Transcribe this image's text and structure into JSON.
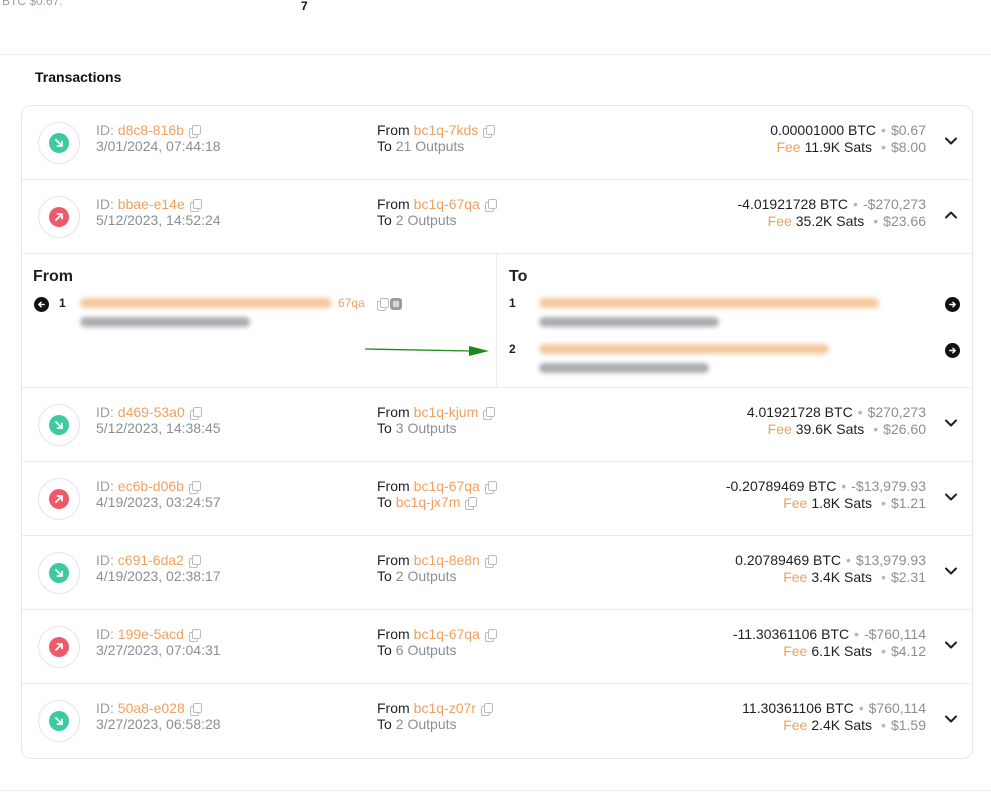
{
  "top_fragment": {
    "btc_hint": "BTC $0.67.",
    "number": "7"
  },
  "section": {
    "title": "Transactions"
  },
  "labels": {
    "id_prefix": "ID:",
    "from": "From",
    "to": "To",
    "fee": "Fee",
    "detail_from": "From",
    "detail_to": "To"
  },
  "transactions": [
    {
      "direction": "in",
      "id": "d8c8-816b",
      "date": "3/01/2024, 07:44:18",
      "from": "bc1q-7kds",
      "to_outputs": "21 Outputs",
      "amount": "0.00001000 BTC",
      "amount_usd": "$0.67",
      "fee_sats": "11.9K Sats",
      "fee_usd": "$8.00",
      "expanded": false
    },
    {
      "direction": "out",
      "id": "bbae-e14e",
      "date": "5/12/2023, 14:52:24",
      "from": "bc1q-67qa",
      "to_outputs": "2 Outputs",
      "amount": "-4.01921728 BTC",
      "amount_usd": "-$270,273",
      "fee_sats": "35.2K Sats",
      "fee_usd": "$23.66",
      "expanded": true
    },
    {
      "direction": "in",
      "id": "d469-53a0",
      "date": "5/12/2023, 14:38:45",
      "from": "bc1q-kjum",
      "to_outputs": "3 Outputs",
      "amount": "4.01921728 BTC",
      "amount_usd": "$270,273",
      "fee_sats": "39.6K Sats",
      "fee_usd": "$26.60",
      "expanded": false
    },
    {
      "direction": "out",
      "id": "ec6b-d06b",
      "date": "4/19/2023, 03:24:57",
      "from": "bc1q-67qa",
      "to_address": "bc1q-jx7m",
      "amount": "-0.20789469 BTC",
      "amount_usd": "-$13,979.93",
      "fee_sats": "1.8K Sats",
      "fee_usd": "$1.21",
      "expanded": false
    },
    {
      "direction": "in",
      "id": "c691-6da2",
      "date": "4/19/2023, 02:38:17",
      "from": "bc1q-8e8n",
      "to_outputs": "2 Outputs",
      "amount": "0.20789469 BTC",
      "amount_usd": "$13,979.93",
      "fee_sats": "3.4K Sats",
      "fee_usd": "$2.31",
      "expanded": false
    },
    {
      "direction": "out",
      "id": "199e-5acd",
      "date": "3/27/2023, 07:04:31",
      "from": "bc1q-67qa",
      "to_outputs": "6 Outputs",
      "amount": "-11.30361106 BTC",
      "amount_usd": "-$760,114",
      "fee_sats": "6.1K Sats",
      "fee_usd": "$4.12",
      "expanded": false
    },
    {
      "direction": "in",
      "id": "50a8-e028",
      "date": "3/27/2023, 06:58:28",
      "from": "bc1q-z07r",
      "to_outputs": "2 Outputs",
      "amount": "11.30361106 BTC",
      "amount_usd": "$760,114",
      "fee_sats": "2.4K Sats",
      "fee_usd": "$1.59",
      "expanded": false
    }
  ],
  "detail": {
    "from_inputs": [
      {
        "index": "1",
        "address_tail": "67qa"
      }
    ],
    "to_outputs": [
      {
        "index": "1"
      },
      {
        "index": "2"
      }
    ]
  },
  "colors": {
    "accent_orange": "#f0a060",
    "incoming_green": "#3ec9a0",
    "outgoing_red": "#ef5a6b",
    "annotation_arrow": "#1a8a1a"
  },
  "icons": {
    "incoming": "arrow-down-right-icon",
    "outgoing": "arrow-up-right-icon",
    "copy": "copy-icon",
    "expand": "chevron-down-icon",
    "collapse": "chevron-up-icon",
    "nav": "circle-arrow-icon"
  }
}
